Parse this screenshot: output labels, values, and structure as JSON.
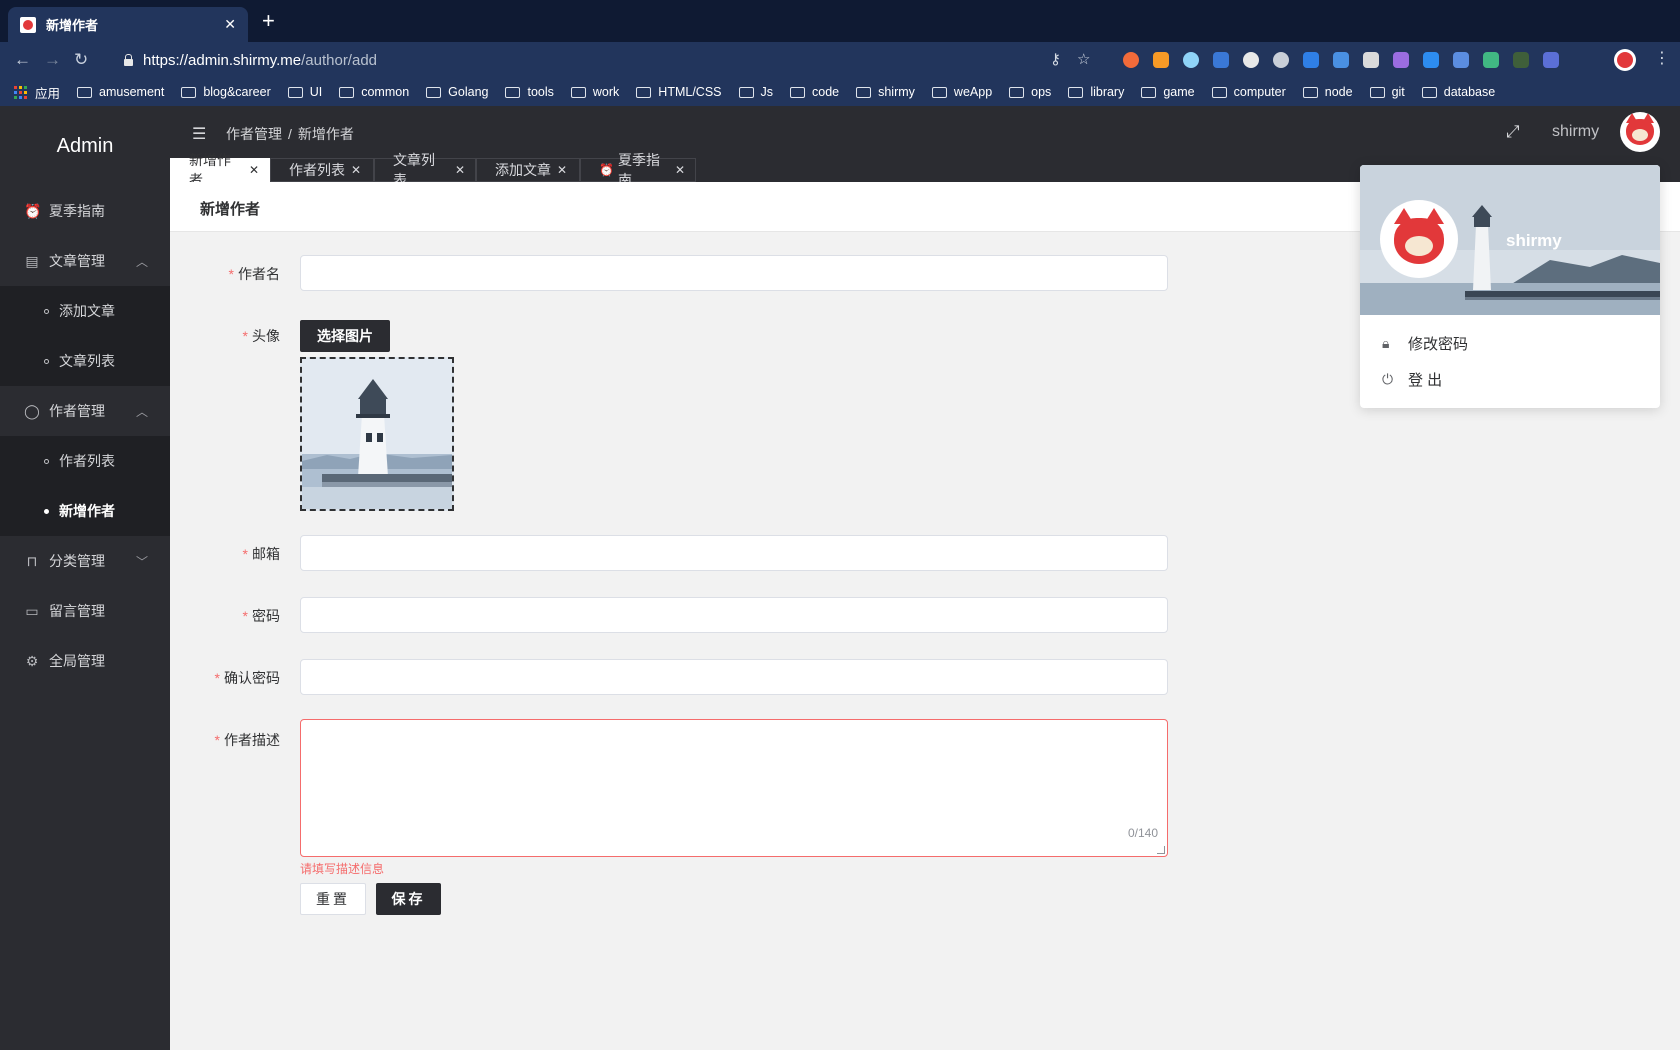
{
  "browser": {
    "tab_title": "新增作者",
    "url_host": "https://admin.shirmy.me",
    "url_path": "/author/add",
    "bookmarks": [
      "应用",
      "amusement",
      "blog&career",
      "UI",
      "common",
      "Golang",
      "tools",
      "work",
      "HTML/CSS",
      "Js",
      "code",
      "shirmy",
      "weApp",
      "ops",
      "library",
      "game",
      "computer",
      "node",
      "git",
      "database"
    ]
  },
  "sidebar": {
    "logo": "Admin",
    "items": [
      {
        "label": "夏季指南",
        "icon": "alarm-icon"
      },
      {
        "label": "文章管理",
        "icon": "document-icon",
        "expanded": true,
        "children": [
          "添加文章",
          "文章列表"
        ]
      },
      {
        "label": "作者管理",
        "icon": "user-icon",
        "expanded": true,
        "children": [
          "作者列表",
          "新增作者"
        ],
        "active_child": "新增作者"
      },
      {
        "label": "分类管理",
        "icon": "bookmark-icon"
      },
      {
        "label": "留言管理",
        "icon": "message-icon"
      },
      {
        "label": "全局管理",
        "icon": "gear-icon"
      }
    ]
  },
  "header": {
    "breadcrumb": [
      "作者管理",
      "新增作者"
    ],
    "username": "shirmy"
  },
  "tags": [
    {
      "label": "新增作者",
      "active": true
    },
    {
      "label": "作者列表"
    },
    {
      "label": "文章列表"
    },
    {
      "label": "添加文章"
    },
    {
      "label": "夏季指南",
      "icon": "alarm-icon"
    }
  ],
  "page": {
    "title": "新增作者",
    "form": {
      "name_label": "作者名",
      "avatar_label": "头像",
      "choose_image": "选择图片",
      "email_label": "邮箱",
      "password_label": "密码",
      "confirm_label": "确认密码",
      "desc_label": "作者描述",
      "desc_counter": "0/140",
      "desc_error": "请填写描述信息",
      "reset": "重置",
      "save": "保存"
    }
  },
  "dropdown": {
    "name": "shirmy",
    "change_password": "修改密码",
    "logout": "登 出"
  },
  "colors": {
    "dark": "#2b2c31",
    "danger": "#f56c6c",
    "brand": "#e2383a"
  }
}
